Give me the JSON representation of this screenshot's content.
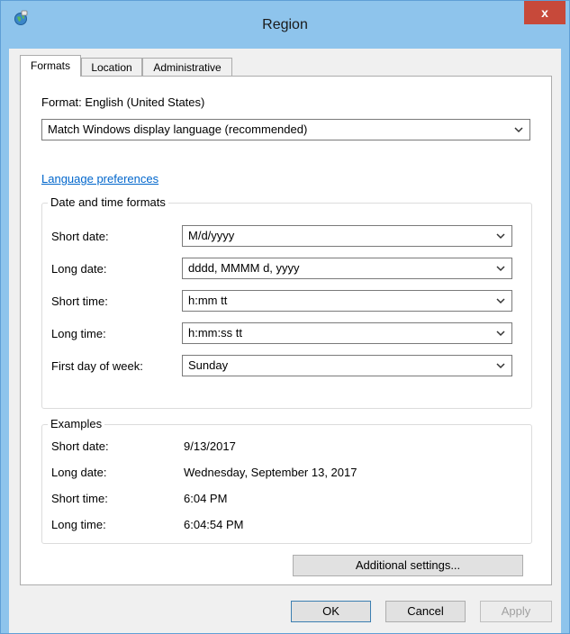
{
  "window": {
    "title": "Region",
    "close_glyph": "x"
  },
  "tabs": [
    {
      "label": "Formats",
      "active": true
    },
    {
      "label": "Location",
      "active": false
    },
    {
      "label": "Administrative",
      "active": false
    }
  ],
  "format": {
    "label": "Format: English (United States)",
    "selected": "Match Windows display language (recommended)"
  },
  "language_preferences_link": "Language preferences",
  "date_time_formats": {
    "title": "Date and time formats",
    "rows": [
      {
        "label": "Short date:",
        "value": "M/d/yyyy"
      },
      {
        "label": "Long date:",
        "value": "dddd, MMMM d, yyyy"
      },
      {
        "label": "Short time:",
        "value": "h:mm tt"
      },
      {
        "label": "Long time:",
        "value": "h:mm:ss tt"
      },
      {
        "label": "First day of week:",
        "value": "Sunday"
      }
    ]
  },
  "examples": {
    "title": "Examples",
    "rows": [
      {
        "label": "Short date:",
        "value": "9/13/2017"
      },
      {
        "label": "Long date:",
        "value": "Wednesday, September 13, 2017"
      },
      {
        "label": "Short time:",
        "value": "6:04 PM"
      },
      {
        "label": "Long time:",
        "value": "6:04:54 PM"
      }
    ]
  },
  "buttons": {
    "additional_settings": "Additional settings...",
    "ok": "OK",
    "cancel": "Cancel",
    "apply": "Apply",
    "apply_enabled": false
  },
  "colors": {
    "title_bar": "#8ec4ec",
    "close_button": "#c7493a",
    "link": "#0066cc"
  },
  "icons": {
    "app": "globe-region-icon",
    "close": "close-icon",
    "dropdown": "chevron-down-icon"
  }
}
